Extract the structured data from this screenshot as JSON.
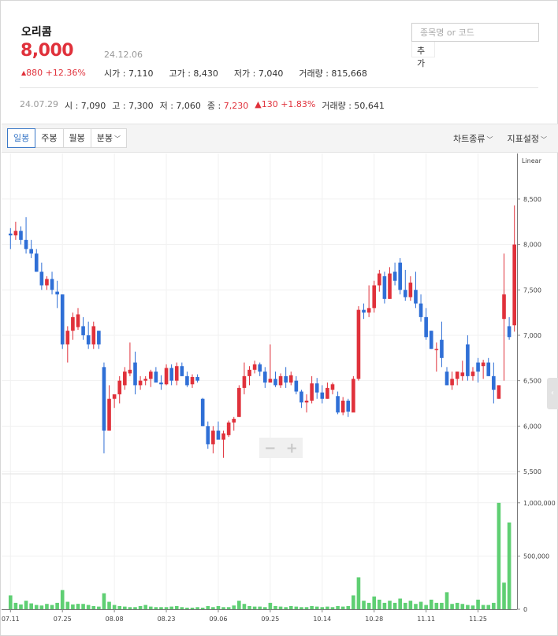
{
  "stock": {
    "name": "오리콤",
    "price": "8,000",
    "date": "24.12.06",
    "change_arrow": "▲",
    "change": "880",
    "change_pct": "+12.36%",
    "stats": [
      {
        "label": "시가 : ",
        "value": "7,110"
      },
      {
        "label": "고가 : ",
        "value": "8,430"
      },
      {
        "label": "저가 : ",
        "value": "7,040"
      },
      {
        "label": "거래량 : ",
        "value": "815,668"
      }
    ]
  },
  "search": {
    "placeholder": "종목명 or 코드",
    "add_label": "추가"
  },
  "history": {
    "date": "24.07.29",
    "open": "시 : 7,090",
    "high": "고 : 7,300",
    "low": "저 : 7,060",
    "close_label": "종 : ",
    "close": "7,230",
    "change": "▲130 +1.83%",
    "volume": "거래량 : 50,641"
  },
  "toolbar": {
    "periods": [
      "일봉",
      "주봉",
      "월봉",
      "분봉"
    ],
    "active": "일봉",
    "chart_type": "차트종류",
    "indicator": "지표설정"
  },
  "colors": {
    "up": "#e0313b",
    "down": "#2f6fd6",
    "volume": "#5fcf73"
  },
  "chart_data": {
    "type": "candlestick",
    "scale": "Linear",
    "price_ticks": [
      "8,500",
      "8,000",
      "7,500",
      "7,000",
      "6,500",
      "6,000",
      "5,500"
    ],
    "price_range": [
      5500,
      8950
    ],
    "volume_ticks": [
      "1,000,000",
      "500,000",
      "0"
    ],
    "volume_range": [
      0,
      1250000
    ],
    "x_labels": [
      "07.11",
      "07.25",
      "08.08",
      "08.23",
      "09.06",
      "09.25",
      "10.14",
      "10.28",
      "11.11",
      "11.25"
    ],
    "x_label_index": [
      0,
      10,
      20,
      30,
      40,
      50,
      60,
      70,
      80,
      90
    ],
    "candles": [
      [
        8120,
        8180,
        7950,
        8100
      ],
      [
        8100,
        8250,
        8050,
        8150
      ],
      [
        8150,
        8200,
        8000,
        8050
      ],
      [
        8050,
        8300,
        7900,
        7950
      ],
      [
        7950,
        8050,
        7850,
        7900
      ],
      [
        7900,
        7950,
        7700,
        7700
      ],
      [
        7700,
        7800,
        7500,
        7550
      ],
      [
        7550,
        7650,
        7500,
        7620
      ],
      [
        7620,
        7700,
        7450,
        7500
      ],
      [
        7480,
        7600,
        7300,
        7450
      ],
      [
        7450,
        7450,
        6850,
        6900
      ],
      [
        6900,
        7100,
        6700,
        7050
      ],
      [
        7050,
        7250,
        6950,
        7200
      ],
      [
        7090,
        7300,
        7060,
        7230
      ],
      [
        7100,
        7200,
        6950,
        7000
      ],
      [
        7000,
        7150,
        6850,
        6900
      ],
      [
        6900,
        7150,
        6850,
        7100
      ],
      [
        7050,
        7050,
        6850,
        6900
      ],
      [
        6650,
        6700,
        5700,
        5950
      ],
      [
        5950,
        6450,
        5950,
        6300
      ],
      [
        6300,
        6350,
        6200,
        6350
      ],
      [
        6350,
        6550,
        6250,
        6500
      ],
      [
        6450,
        6650,
        6400,
        6600
      ],
      [
        6580,
        6920,
        6550,
        6620
      ],
      [
        6700,
        6820,
        6350,
        6450
      ],
      [
        6450,
        6550,
        6400,
        6500
      ],
      [
        6500,
        6550,
        6450,
        6520
      ],
      [
        6520,
        6620,
        6430,
        6600
      ],
      [
        6600,
        6650,
        6500,
        6480
      ],
      [
        6480,
        6560,
        6400,
        6460
      ],
      [
        6460,
        6680,
        6450,
        6640
      ],
      [
        6640,
        6680,
        6450,
        6500
      ],
      [
        6500,
        6700,
        6450,
        6660
      ],
      [
        6660,
        6700,
        6550,
        6550
      ],
      [
        6550,
        6600,
        6430,
        6450
      ],
      [
        6460,
        6570,
        6420,
        6540
      ],
      [
        6540,
        6570,
        6480,
        6500
      ],
      [
        6300,
        6310,
        6000,
        6000
      ],
      [
        6000,
        6050,
        5750,
        5800
      ],
      [
        5800,
        6000,
        5700,
        5950
      ],
      [
        5950,
        6050,
        5900,
        5850
      ],
      [
        5850,
        5950,
        5650,
        5920
      ],
      [
        5900,
        6060,
        5880,
        6040
      ],
      [
        6040,
        6100,
        5950,
        6080
      ],
      [
        6100,
        6450,
        6100,
        6420
      ],
      [
        6420,
        6700,
        6350,
        6550
      ],
      [
        6550,
        6660,
        6450,
        6620
      ],
      [
        6620,
        6720,
        6580,
        6680
      ],
      [
        6680,
        6700,
        6550,
        6600
      ],
      [
        6600,
        6650,
        6420,
        6480
      ],
      [
        6480,
        6900,
        6480,
        6520
      ],
      [
        6520,
        6600,
        6430,
        6450
      ],
      [
        6450,
        6580,
        6420,
        6550
      ],
      [
        6550,
        6650,
        6420,
        6480
      ],
      [
        6480,
        6600,
        6450,
        6560
      ],
      [
        6500,
        6550,
        6350,
        6380
      ],
      [
        6380,
        6400,
        6200,
        6260
      ],
      [
        6260,
        6350,
        6150,
        6280
      ],
      [
        6280,
        6550,
        6250,
        6470
      ],
      [
        6470,
        6530,
        6300,
        6370
      ],
      [
        6370,
        6450,
        6250,
        6300
      ],
      [
        6300,
        6480,
        6300,
        6420
      ],
      [
        6400,
        6480,
        6350,
        6460
      ],
      [
        6330,
        6380,
        6130,
        6150
      ],
      [
        6150,
        6320,
        6120,
        6280
      ],
      [
        6280,
        6300,
        6100,
        6160
      ],
      [
        6150,
        6550,
        6150,
        6520
      ],
      [
        6520,
        7320,
        6500,
        7280
      ],
      [
        7280,
        7350,
        7180,
        7250
      ],
      [
        7250,
        7550,
        7200,
        7300
      ],
      [
        7300,
        7600,
        7250,
        7550
      ],
      [
        7550,
        7720,
        7480,
        7680
      ],
      [
        7650,
        7700,
        7350,
        7400
      ],
      [
        7400,
        7750,
        7400,
        7680
      ],
      [
        7700,
        7800,
        7550,
        7600
      ],
      [
        7800,
        7850,
        7450,
        7500
      ],
      [
        7500,
        7720,
        7380,
        7420
      ],
      [
        7420,
        7650,
        7380,
        7580
      ],
      [
        7500,
        7700,
        7300,
        7350
      ],
      [
        7350,
        7450,
        7150,
        7200
      ],
      [
        7200,
        7300,
        6950,
        6980
      ],
      [
        7050,
        7050,
        6850,
        6850
      ],
      [
        6850,
        6920,
        6600,
        6850
      ],
      [
        6950,
        7150,
        6650,
        6750
      ],
      [
        6600,
        6650,
        6450,
        6450
      ],
      [
        6450,
        6600,
        6400,
        6520
      ],
      [
        6520,
        6600,
        6450,
        6600
      ],
      [
        6550,
        6720,
        6500,
        6590
      ],
      [
        6900,
        7000,
        6500,
        6550
      ],
      [
        6550,
        6650,
        6500,
        6600
      ],
      [
        6700,
        6750,
        6480,
        6600
      ],
      [
        6660,
        6730,
        6520,
        6700
      ],
      [
        6700,
        6750,
        6550,
        6550
      ],
      [
        6550,
        6700,
        6250,
        6400
      ],
      [
        6300,
        6450,
        6300,
        6450
      ],
      [
        7180,
        7900,
        6500,
        7450
      ],
      [
        7100,
        7200,
        6950,
        6980
      ],
      [
        7110,
        8430,
        7040,
        8000
      ]
    ],
    "volumes": [
      130000,
      60000,
      45000,
      80000,
      55000,
      40000,
      35000,
      50000,
      40000,
      60000,
      180000,
      70000,
      45000,
      50641,
      50000,
      40000,
      30000,
      25000,
      150000,
      70000,
      40000,
      30000,
      25000,
      20000,
      20000,
      30000,
      40000,
      25000,
      20000,
      20000,
      20000,
      25000,
      30000,
      20000,
      15000,
      15000,
      20000,
      15000,
      30000,
      20000,
      30000,
      20000,
      20000,
      35000,
      80000,
      50000,
      30000,
      25000,
      25000,
      20000,
      60000,
      30000,
      25000,
      20000,
      30000,
      25000,
      20000,
      20000,
      30000,
      25000,
      20000,
      25000,
      20000,
      30000,
      25000,
      30000,
      130000,
      300000,
      80000,
      60000,
      120000,
      90000,
      60000,
      80000,
      60000,
      100000,
      60000,
      80000,
      50000,
      70000,
      40000,
      90000,
      60000,
      60000,
      160000,
      50000,
      60000,
      50000,
      40000,
      35000,
      90000,
      40000,
      40000,
      60000,
      1000000,
      250000,
      815668
    ]
  }
}
